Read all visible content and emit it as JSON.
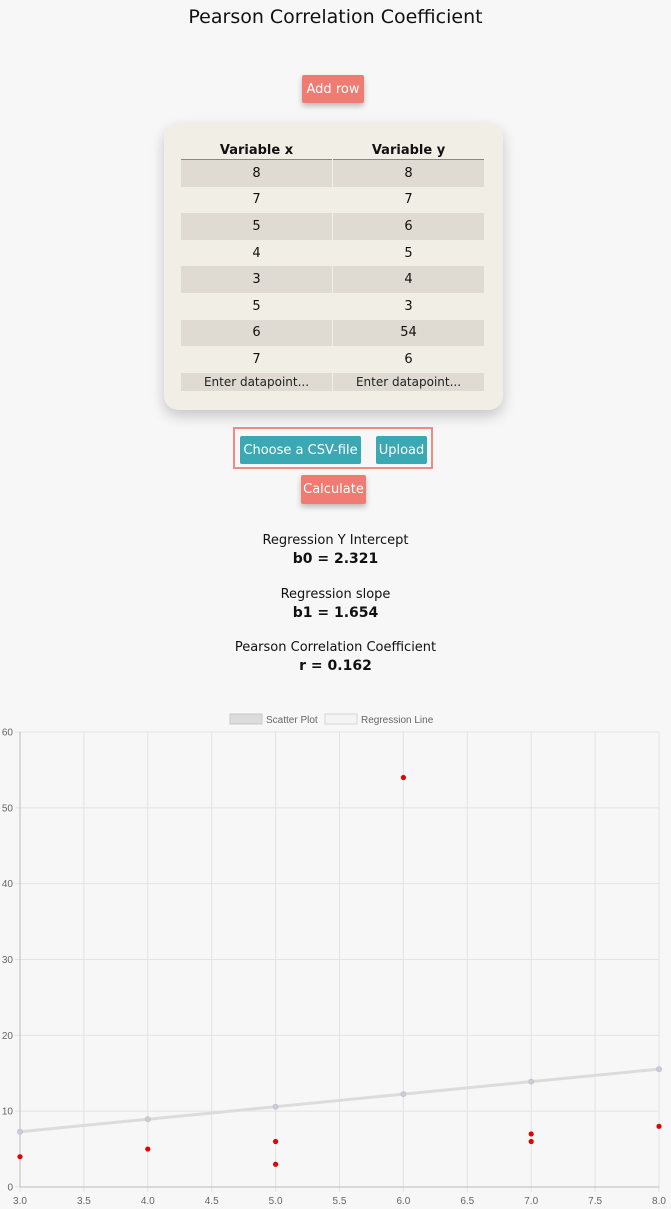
{
  "page": {
    "title": "Pearson Correlation Coefficient"
  },
  "buttons": {
    "add_row": "Add row",
    "choose_csv": "Choose a CSV-file",
    "upload": "Upload",
    "calculate": "Calculate"
  },
  "table": {
    "headers": [
      "Variable x",
      "Variable y"
    ],
    "rows": [
      [
        "8",
        "8"
      ],
      [
        "7",
        "7"
      ],
      [
        "5",
        "6"
      ],
      [
        "4",
        "5"
      ],
      [
        "3",
        "4"
      ],
      [
        "5",
        "3"
      ],
      [
        "6",
        "54"
      ],
      [
        "7",
        "6"
      ]
    ],
    "placeholder": "Enter datapoint..."
  },
  "results": {
    "b0_label": "Regression Y Intercept",
    "b0_value": "b0 = 2.321",
    "b1_label": "Regression slope",
    "b1_value": "b1 = 1.654",
    "r_label": "Pearson Correlation Coefficient",
    "r_value": "r = 0.162"
  },
  "colors": {
    "coral": "#f07b72",
    "teal": "#3aa9b4",
    "point": "#e60000",
    "line": "#dcdcdc"
  },
  "chart_data": {
    "type": "scatter",
    "legend": [
      "Scatter Plot",
      "Regression Line"
    ],
    "legend_position": "top",
    "xlim": [
      3.0,
      8.0
    ],
    "ylim": [
      0,
      60
    ],
    "x_ticks": [
      "3.0",
      "3.5",
      "4.0",
      "4.5",
      "5.0",
      "5.5",
      "6.0",
      "6.5",
      "7.0",
      "7.5",
      "8.0"
    ],
    "y_ticks": [
      "0",
      "10",
      "20",
      "30",
      "40",
      "50",
      "60"
    ],
    "grid": true,
    "series": [
      {
        "name": "Scatter Plot",
        "points": [
          [
            8,
            8
          ],
          [
            7,
            7
          ],
          [
            5,
            6
          ],
          [
            4,
            5
          ],
          [
            3,
            4
          ],
          [
            5,
            3
          ],
          [
            6,
            54
          ],
          [
            7,
            6
          ]
        ]
      },
      {
        "name": "Regression Line",
        "points": [
          [
            3,
            7.28
          ],
          [
            4,
            8.94
          ],
          [
            5,
            10.59
          ],
          [
            6,
            12.25
          ],
          [
            7,
            13.9
          ],
          [
            8,
            15.55
          ]
        ]
      }
    ]
  }
}
